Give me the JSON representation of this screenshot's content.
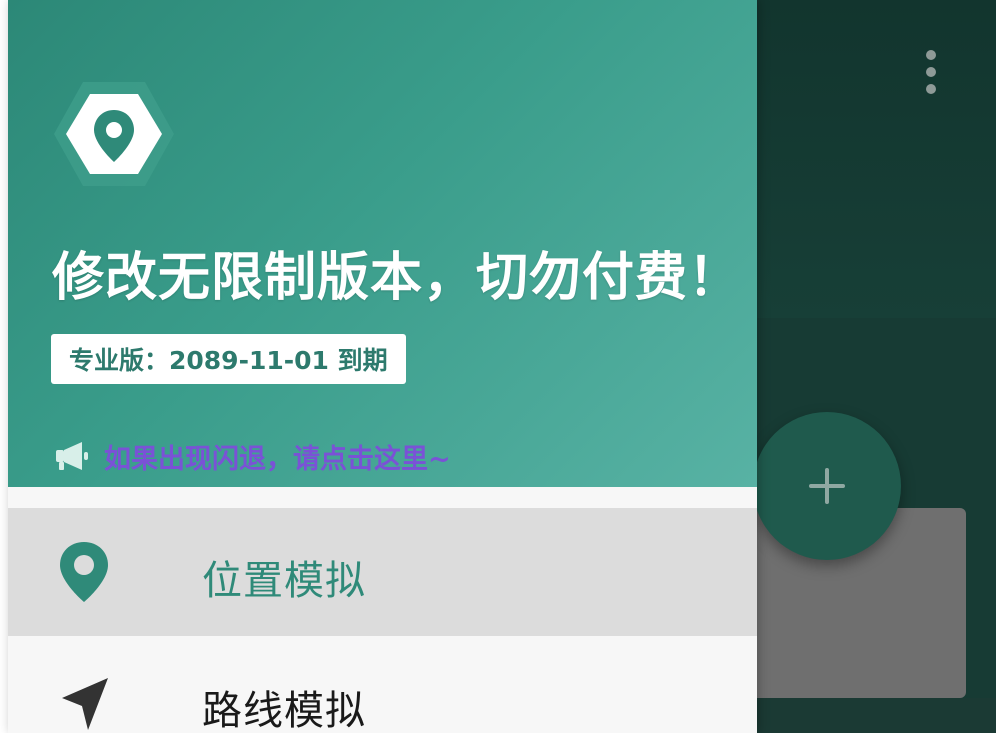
{
  "drawer": {
    "promo_title": "修改无限制版本，切勿付费！",
    "license_badge": "专业版：2089-11-01 到期",
    "notice": "如果出现闪退，请点击这里~",
    "menu": [
      {
        "label": "位置模拟",
        "icon": "location-pin-icon",
        "active": true
      },
      {
        "label": "路线模拟",
        "icon": "navigation-arrow-icon",
        "active": false
      }
    ]
  },
  "colors": {
    "header_start": "#2c8877",
    "header_end": "#58b2a4",
    "accent": "#2f8a79",
    "notice_text": "#7a52d6",
    "active_row": "#dcdcdc"
  }
}
